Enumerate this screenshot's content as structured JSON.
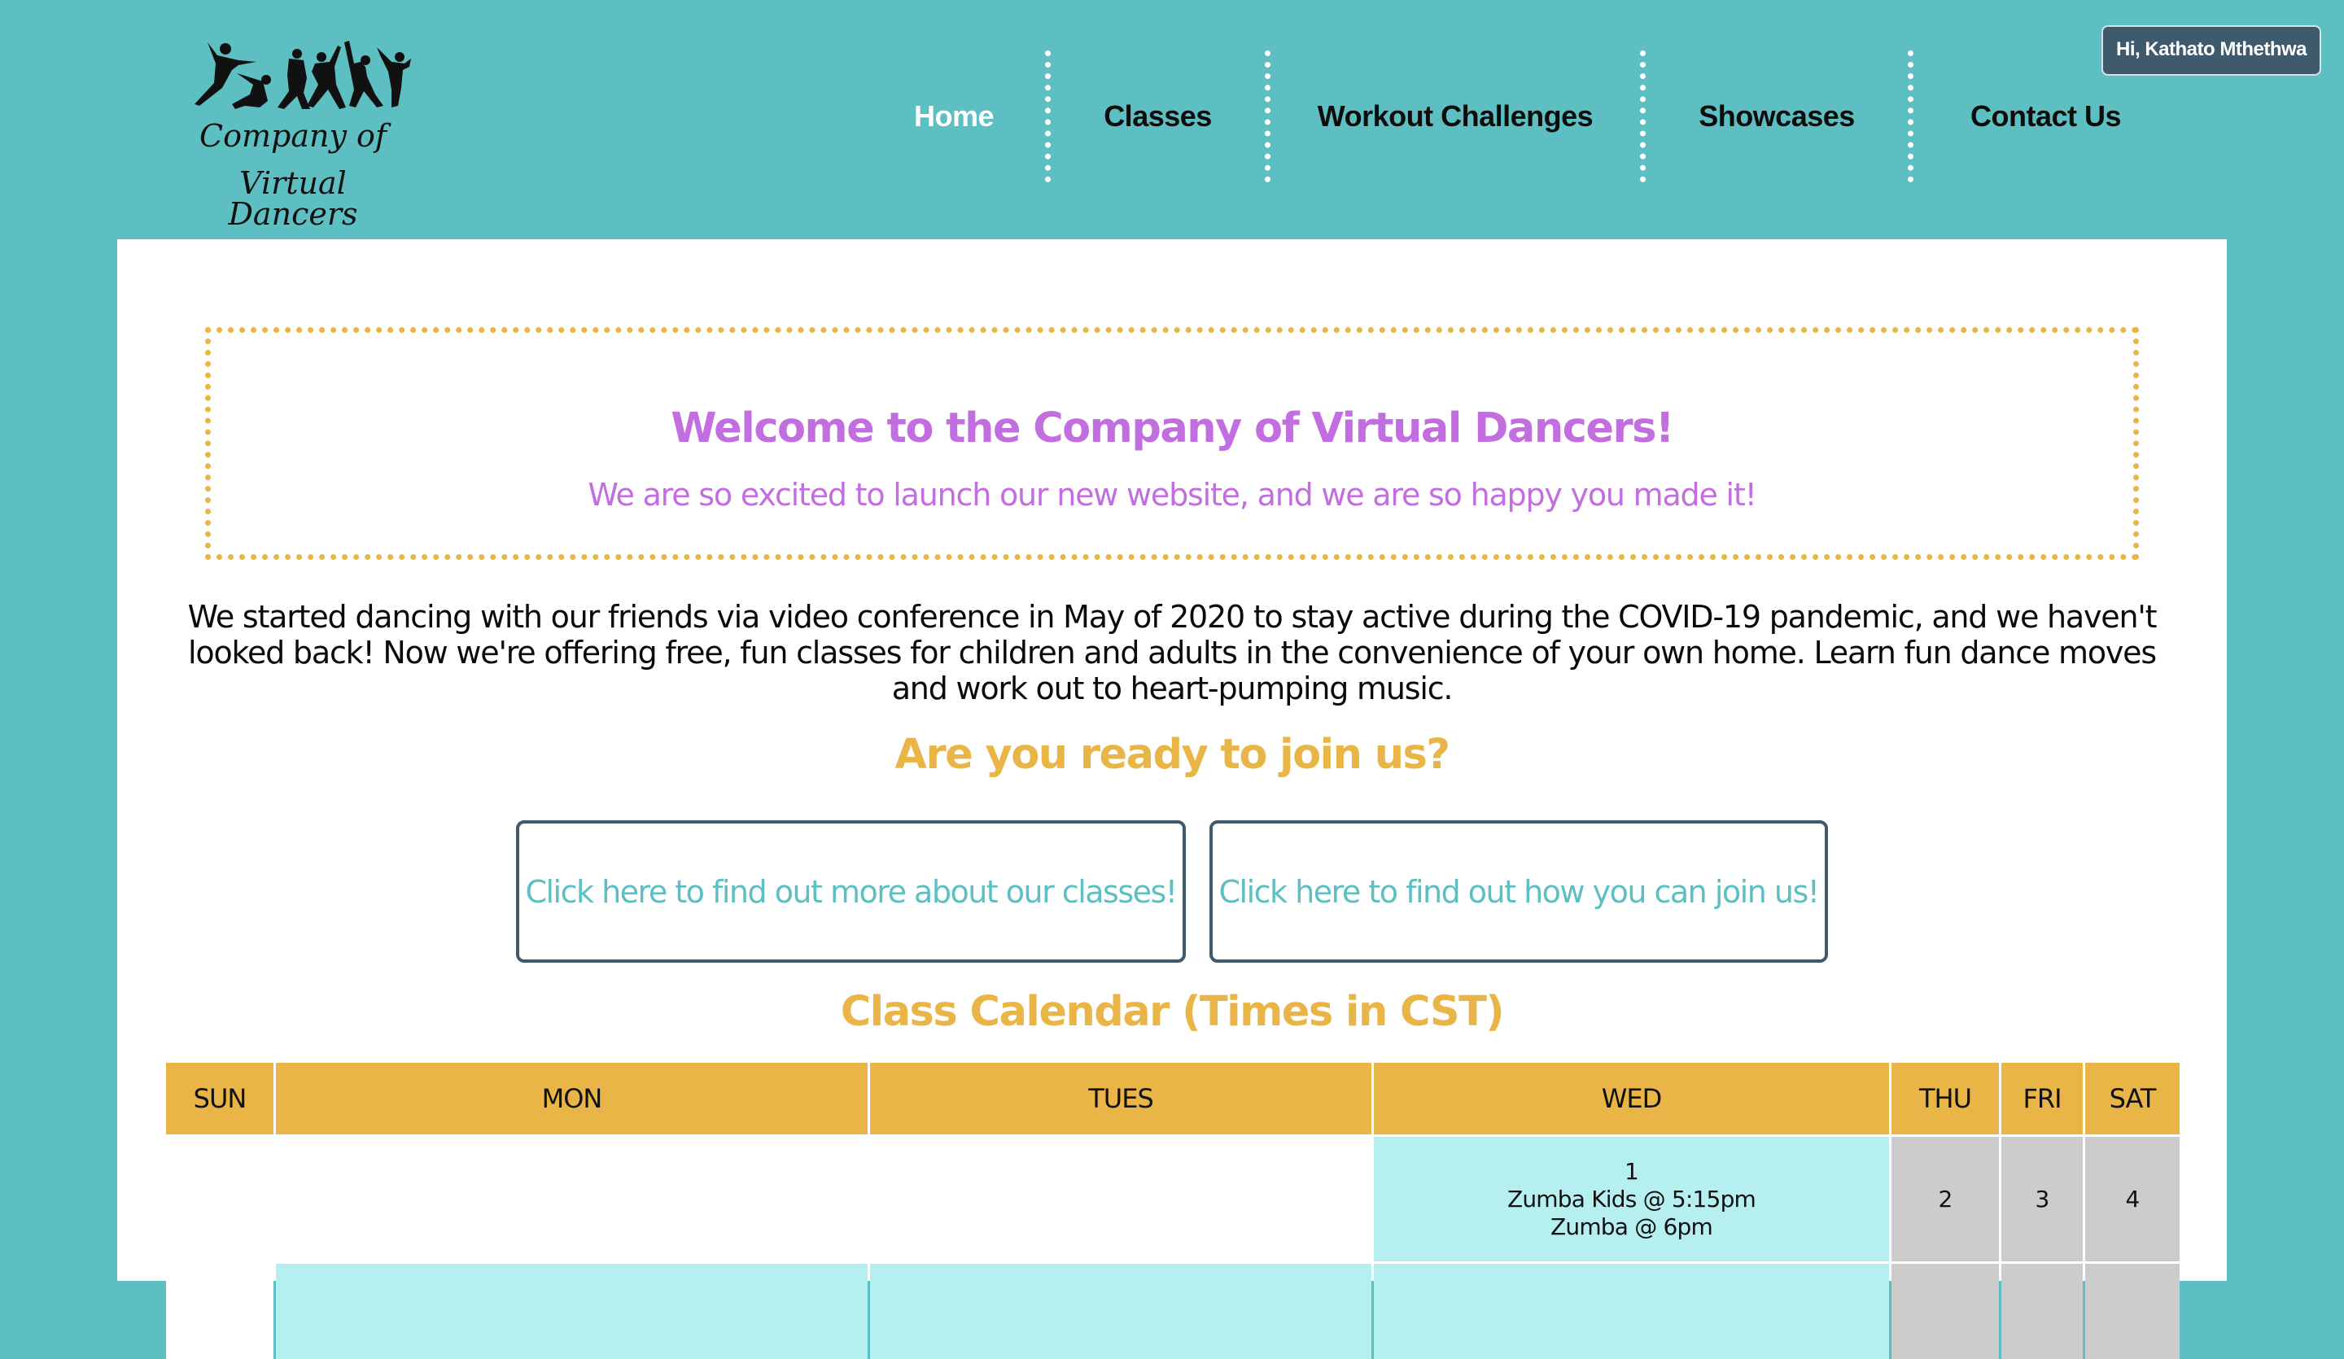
{
  "header": {
    "logo": {
      "line1": "Company of",
      "line2": "Virtual Dancers",
      "icon": "dancers-silhouette-icon"
    },
    "nav": [
      {
        "label": "Home",
        "active": true
      },
      {
        "label": "Classes",
        "active": false
      },
      {
        "label": "Workout Challenges",
        "active": false
      },
      {
        "label": "Showcases",
        "active": false
      },
      {
        "label": "Contact Us",
        "active": false
      }
    ],
    "user_greeting": "Hi, Kathato Mthethwa"
  },
  "welcome": {
    "title": "Welcome to the Company of Virtual Dancers!",
    "subtitle": "We are so excited to launch our new website, and we are so happy you made it!"
  },
  "intro": "We started dancing with our friends via video conference in May of 2020 to stay active during the COVID-19 pandemic, and we haven't looked back! Now we're offering free, fun classes for children and adults in the convenience of your own home. Learn fun dance moves and work out to heart-pumping music.",
  "join": {
    "heading": "Are you ready to join us?",
    "buttons": [
      {
        "label": "Click here to find out more about our classes!"
      },
      {
        "label": "Click here to find out how you can join us!"
      }
    ]
  },
  "calendar": {
    "heading": "Class Calendar (Times in CST)",
    "days": [
      "SUN",
      "MON",
      "TUES",
      "WED",
      "THU",
      "FRI",
      "SAT"
    ],
    "rows": [
      [
        {
          "day": "",
          "events": [],
          "type": "empty"
        },
        {
          "day": "",
          "events": [],
          "type": "empty"
        },
        {
          "day": "",
          "events": [],
          "type": "empty"
        },
        {
          "day": "1",
          "events": [
            "Zumba Kids @ 5:15pm",
            "Zumba @ 6pm"
          ],
          "type": "class-day"
        },
        {
          "day": "2",
          "events": [],
          "type": "off-day"
        },
        {
          "day": "3",
          "events": [],
          "type": "off-day"
        },
        {
          "day": "4",
          "events": [],
          "type": "off-day"
        }
      ],
      [
        {
          "day": "",
          "events": [],
          "type": "empty"
        },
        {
          "day": "",
          "events": [],
          "type": "class-day"
        },
        {
          "day": "",
          "events": [],
          "type": "class-day"
        },
        {
          "day": "",
          "events": [],
          "type": "class-day"
        },
        {
          "day": "",
          "events": [],
          "type": "off-day"
        },
        {
          "day": "",
          "events": [],
          "type": "off-day"
        },
        {
          "day": "",
          "events": [],
          "type": "off-day"
        }
      ]
    ]
  },
  "colors": {
    "page_bg": "#5dbfc2",
    "accent_gold": "#e9b546",
    "accent_purple": "#c26ee0",
    "badge_bg": "#3e5a6c",
    "class_day": "#b6eff0",
    "off_day": "#cccccc"
  }
}
